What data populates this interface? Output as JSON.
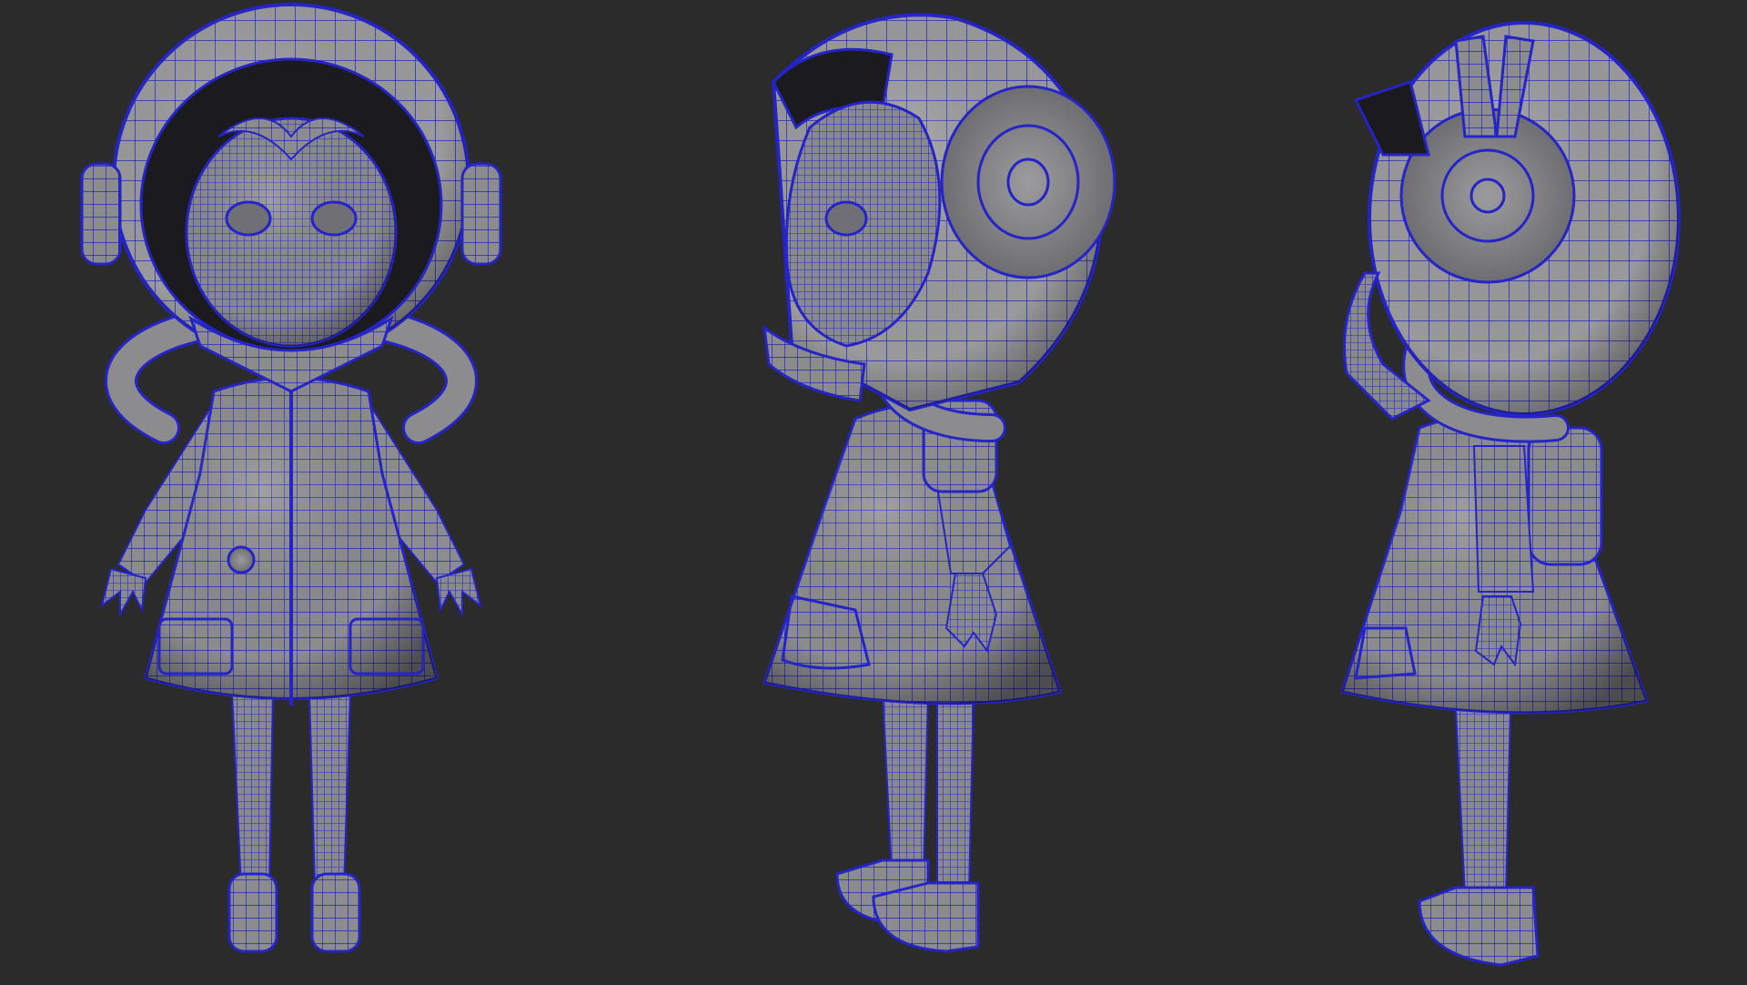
{
  "scene": {
    "background_color": "#2b2b2b",
    "mesh_fill_color": "#8c8c8e",
    "mesh_shade_color": "#5e5e62",
    "wire_color": "#2424c8",
    "views": [
      {
        "id": "front",
        "name": "front-view"
      },
      {
        "id": "three-quarter",
        "name": "three-quarter-view"
      },
      {
        "id": "side",
        "name": "side-view"
      }
    ]
  }
}
